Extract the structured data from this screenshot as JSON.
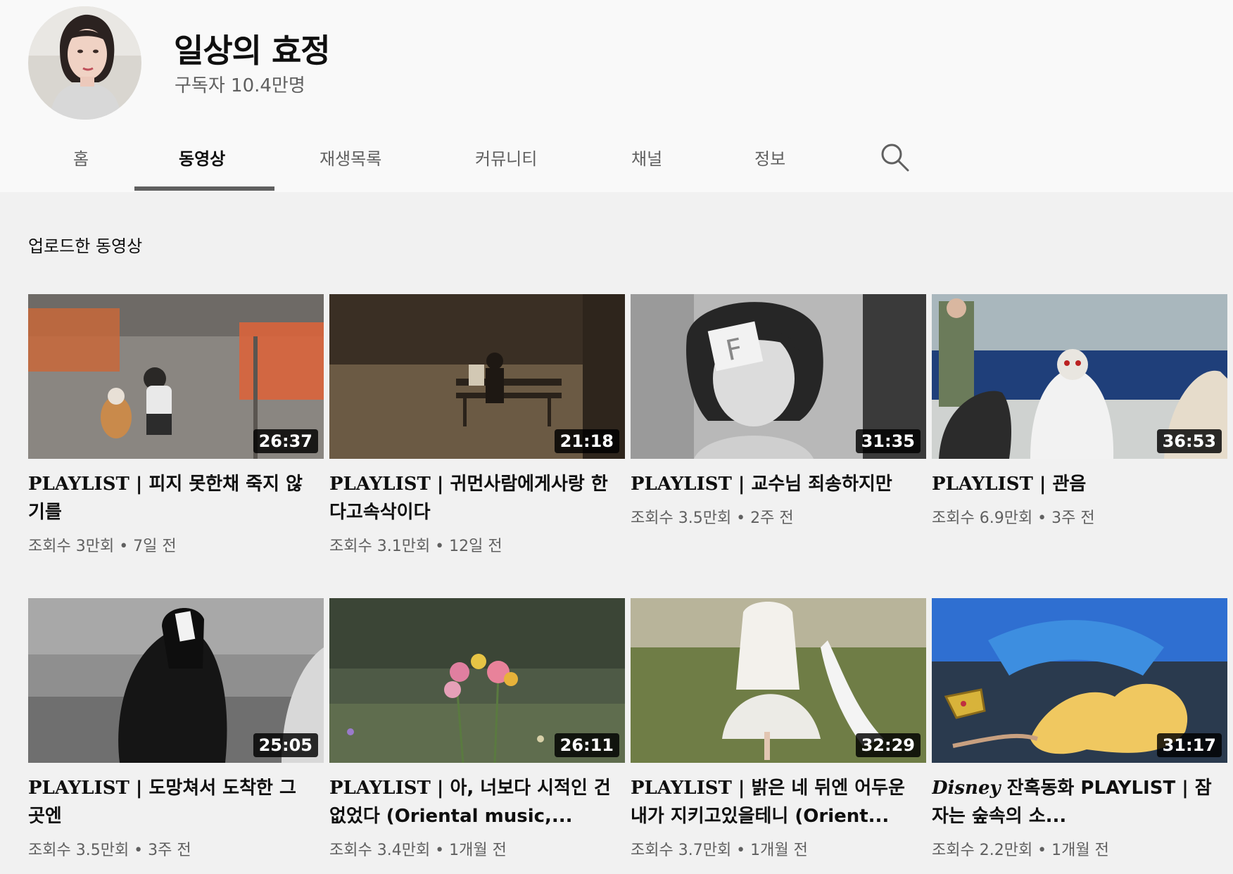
{
  "channel": {
    "name": "일상의 효정",
    "subscribers": "구독자 10.4만명"
  },
  "tabs": [
    {
      "label": "홈"
    },
    {
      "label": "동영상"
    },
    {
      "label": "재생목록"
    },
    {
      "label": "커뮤니티"
    },
    {
      "label": "채널"
    },
    {
      "label": "정보"
    }
  ],
  "search_icon": "search-icon",
  "section": {
    "title": "업로드한 동영상"
  },
  "videos": [
    {
      "prefix": "PLAYLIST",
      "title": " | 피지 못한채 죽지 않기를",
      "duration": "26:37",
      "views": "조회수 3만회",
      "age": "7일 전"
    },
    {
      "prefix": "PLAYLIST",
      "title": " | 귀먼사람에게사랑 한다고속삭이다",
      "duration": "21:18",
      "views": "조회수 3.1만회",
      "age": "12일 전"
    },
    {
      "prefix": "PLAYLIST",
      "title": " | 교수님 죄송하지만",
      "duration": "31:35",
      "views": "조회수 3.5만회",
      "age": "2주 전"
    },
    {
      "prefix": "PLAYLIST",
      "title": " | 관음",
      "duration": "36:53",
      "views": "조회수 6.9만회",
      "age": "3주 전"
    },
    {
      "prefix": "PLAYLIST",
      "title": " | 도망쳐서 도착한 그 곳엔",
      "duration": "25:05",
      "views": "조회수 3.5만회",
      "age": "3주 전"
    },
    {
      "prefix": "PLAYLIST",
      "title": " | 아, 너보다 시적인 건 없었다 (Oriental music,...",
      "duration": "26:11",
      "views": "조회수 3.4만회",
      "age": "1개월 전"
    },
    {
      "prefix": "PLAYLIST",
      "title": " | 밝은 네 뒤엔 어두운 내가 지키고있을테니 (Orient...",
      "duration": "32:29",
      "views": "조회수 3.7만회",
      "age": "1개월 전"
    },
    {
      "prefix": "Disney",
      "title": " 잔혹동화 PLAYLIST | 잠자는 숲속의 소...",
      "duration": "31:17",
      "views": "조회수 2.2만회",
      "age": "1개월 전"
    }
  ]
}
